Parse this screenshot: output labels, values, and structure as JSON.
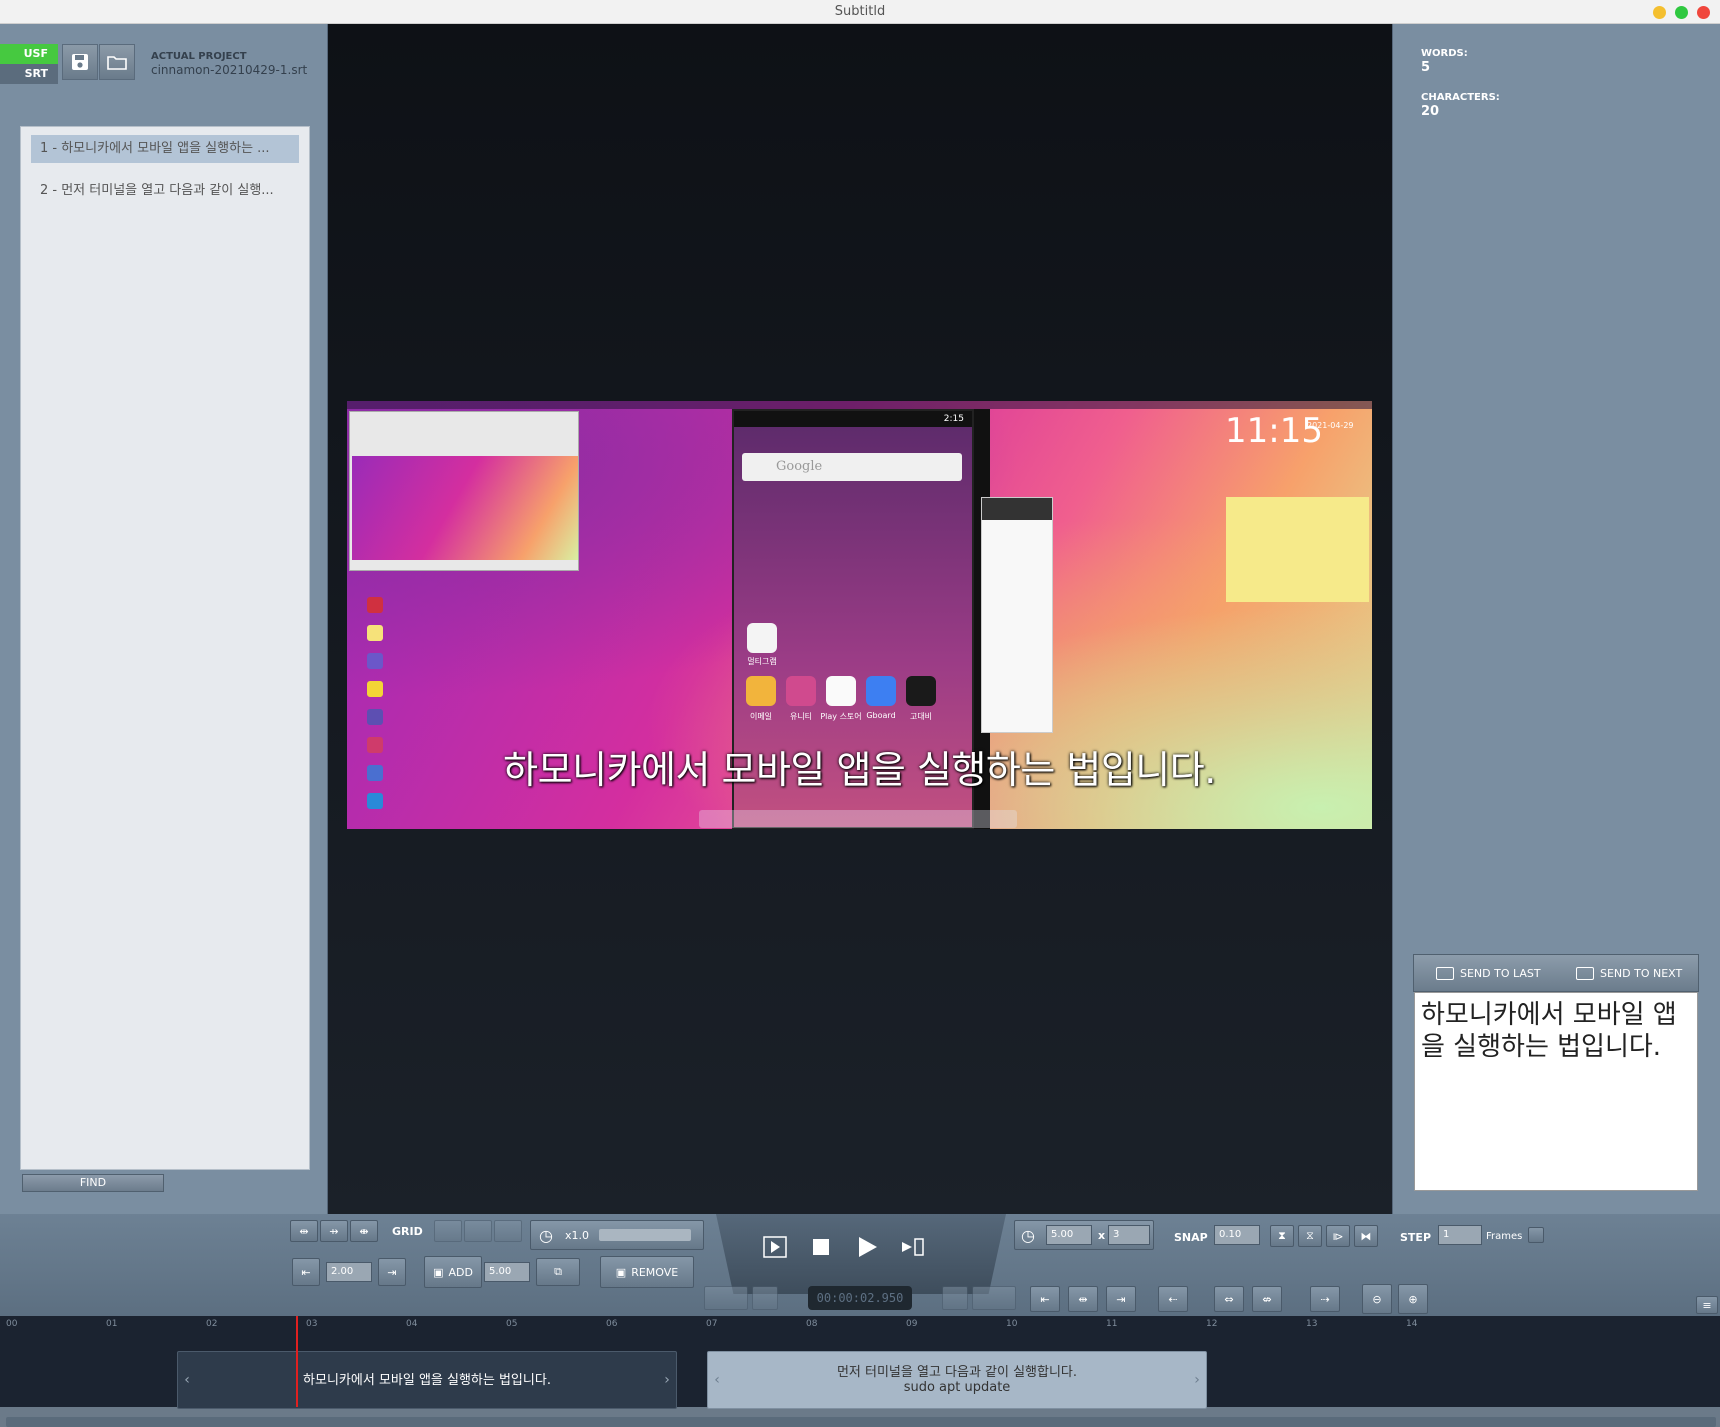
{
  "window": {
    "title": "Subtitld"
  },
  "formats": {
    "usf": "USF",
    "srt": "SRT"
  },
  "project": {
    "label": "ACTUAL PROJECT",
    "filename": "cinnamon-20210429-1.srt"
  },
  "subtitles": [
    {
      "label": "1 - 하모니카에서 모바일 앱을 실행하는 ..."
    },
    {
      "label": "2 - 먼저 터미널을 열고 다음과 같이 실행..."
    }
  ],
  "find_button": "FIND",
  "video": {
    "subtitle_overlay": "하모니카에서 모바일 앱을 실행하는 법입니다.",
    "search_placeholder": "Google",
    "clock": "11:15",
    "clock_date": "2021-04-29",
    "phone_time": "2:15",
    "app_labels": [
      "이메일",
      "유니티",
      "Play 스토어",
      "Gboard",
      "고대비"
    ],
    "top_app_label": "멀티그램"
  },
  "stats": {
    "words_label": "WORDS:",
    "words": "5",
    "chars_label": "CHARACTERS:",
    "chars": "20"
  },
  "send": {
    "last": "SEND TO LAST",
    "next": "SEND TO NEXT"
  },
  "editor_text": "하모니카에서 모바일 앱을 실행하는 법입니다.",
  "controls": {
    "grid": "GRID",
    "speed": "x1.0",
    "duration": "2.00",
    "add": "ADD",
    "add_value": "5.00",
    "remove": "REMOVE",
    "timer_value": "5.00",
    "times": "x",
    "repeat": "3",
    "snap": "SNAP",
    "snap_value": "0.10",
    "step": "STEP",
    "step_value": "1",
    "step_unit": "Frames",
    "timecode": "00:00:02.950"
  },
  "ruler": [
    "00",
    "01",
    "02",
    "03",
    "04",
    "05",
    "06",
    "07",
    "08",
    "09",
    "10",
    "11",
    "12",
    "13",
    "14"
  ],
  "clips": [
    {
      "line1": "하모니카에서 모바일 앱을 실행하는 법입니다.",
      "line2": ""
    },
    {
      "line1": "먼저 터미널을 열고 다음과 같이 실행합니다.",
      "line2": "sudo apt update"
    }
  ],
  "colors": {
    "usf": "#46c940",
    "selected": "#b3c4d6",
    "playhead": "#e02020",
    "clip_selected": "#2e3b4b",
    "clip_other": "#a7b7c7"
  }
}
